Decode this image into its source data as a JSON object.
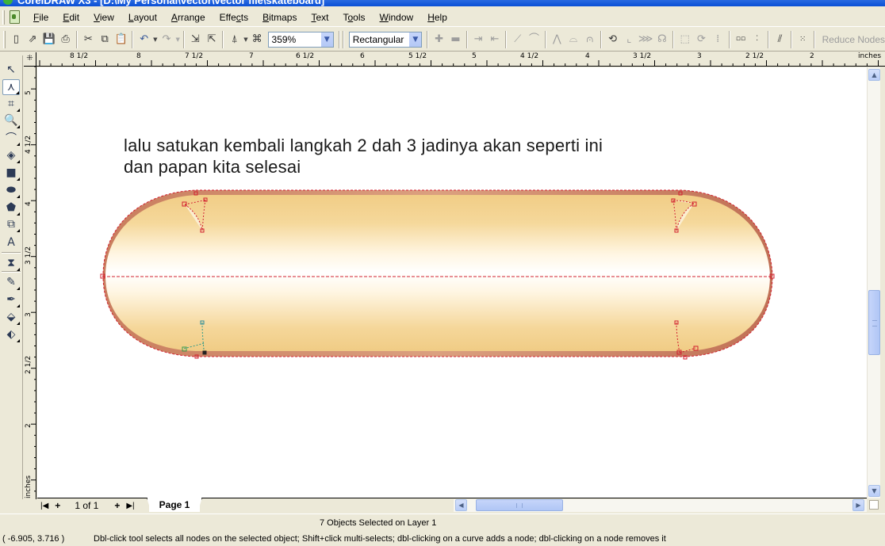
{
  "window": {
    "title": "CorelDRAW X3 - [D:\\My Personal\\vector\\vector file\\skateboard]"
  },
  "menubar": {
    "items": [
      {
        "label": "File",
        "accel": "F"
      },
      {
        "label": "Edit",
        "accel": "E"
      },
      {
        "label": "View",
        "accel": "V"
      },
      {
        "label": "Layout",
        "accel": "L"
      },
      {
        "label": "Arrange",
        "accel": "A"
      },
      {
        "label": "Effects",
        "accel": "c"
      },
      {
        "label": "Bitmaps",
        "accel": "B"
      },
      {
        "label": "Text",
        "accel": "T"
      },
      {
        "label": "Tools",
        "accel": "o"
      },
      {
        "label": "Window",
        "accel": "W"
      },
      {
        "label": "Help",
        "accel": "H"
      }
    ]
  },
  "toolbar": {
    "zoom_value": "359%",
    "marquee_mode": "Rectangular",
    "reduce_nodes_label": "Reduce Nodes",
    "icons": {
      "new": "new-document-icon",
      "open": "open-icon",
      "save": "save-icon",
      "print": "print-icon",
      "cut": "cut-icon",
      "copy": "copy-icon",
      "paste": "paste-icon",
      "undo": "undo-icon",
      "redo": "redo-icon",
      "import": "import-icon",
      "export": "export-icon",
      "launcher": "application-launcher-icon",
      "snap": "snap-to-icon"
    }
  },
  "rulers": {
    "unit": "inches",
    "horizontal_labels": [
      "8 1/2",
      "8",
      "7 1/2",
      "7",
      "6 1/2",
      "6",
      "5 1/2",
      "5",
      "4 1/2",
      "4",
      "3 1/2",
      "3",
      "2 1/2",
      "2",
      "inches"
    ],
    "vertical_labels": [
      "5",
      "4 1/2",
      "4",
      "3 1/2",
      "3",
      "2 1/2",
      "2",
      "inches"
    ]
  },
  "toolbox": {
    "tools": [
      {
        "name": "pick-tool",
        "glyph": "↖"
      },
      {
        "name": "shape-tool",
        "glyph": "⋏",
        "active": true
      },
      {
        "name": "crop-tool",
        "glyph": "⌗"
      },
      {
        "name": "zoom-tool",
        "glyph": "🔍"
      },
      {
        "name": "freehand-tool",
        "glyph": "⌒"
      },
      {
        "name": "smart-fill-tool",
        "glyph": "◈"
      },
      {
        "name": "rectangle-tool",
        "glyph": "■"
      },
      {
        "name": "ellipse-tool",
        "glyph": "⬬"
      },
      {
        "name": "polygon-tool",
        "glyph": "⬟"
      },
      {
        "name": "basic-shapes-tool",
        "glyph": "⧉"
      },
      {
        "name": "text-tool",
        "glyph": "A"
      },
      {
        "name": "interactive-blend-tool",
        "glyph": "⧗"
      },
      {
        "name": "eyedropper-tool",
        "glyph": "✎"
      },
      {
        "name": "outline-tool",
        "glyph": "✒"
      },
      {
        "name": "fill-tool",
        "glyph": "⬙"
      },
      {
        "name": "interactive-fill-tool",
        "glyph": "⬖"
      }
    ]
  },
  "canvas": {
    "instruction_line1": "lalu satukan kembali langkah 2 dah 3 jadinya akan seperti ini",
    "instruction_line2": "dan papan kita selesai",
    "board_colors": {
      "outline": "#c07a5c",
      "fill_edge": "#f1cd86",
      "fill_center": "#ffffff",
      "selection": "#d1202f",
      "node_alt": "#2a9a8a"
    }
  },
  "page_nav": {
    "first": "|◀",
    "add_before": "+",
    "counter": "1 of 1",
    "add_after": "+",
    "last": "▶|",
    "tab_label": "Page 1"
  },
  "status": {
    "selection": "7 Objects Selected on Layer 1",
    "coordinates": "( -6.905, 3.716  )",
    "hint": "Dbl-click tool selects all nodes on the selected object; Shift+click multi-selects; dbl-clicking on a curve adds a node; dbl-clicking on a node removes it"
  }
}
